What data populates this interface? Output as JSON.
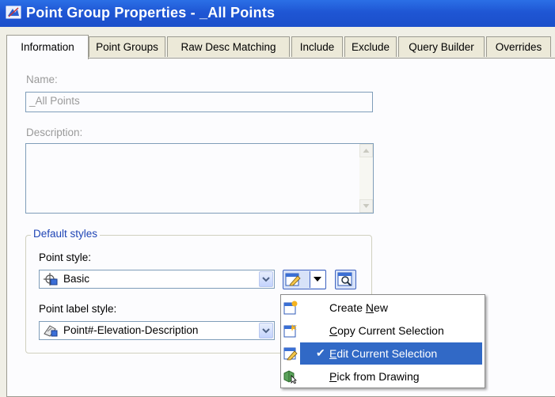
{
  "window": {
    "title": "Point Group Properties - _All Points"
  },
  "tabs": [
    {
      "label": "Information"
    },
    {
      "label": "Point Groups"
    },
    {
      "label": "Raw Desc Matching"
    },
    {
      "label": "Include"
    },
    {
      "label": "Exclude"
    },
    {
      "label": "Query Builder"
    },
    {
      "label": "Overrides"
    }
  ],
  "info": {
    "name_label": "Name:",
    "name_value": "_All Points",
    "description_label": "Description:",
    "description_value": "",
    "default_styles_label": "Default styles",
    "point_style_label": "Point style:",
    "point_style_value": "Basic",
    "point_label_style_label": "Point label style:",
    "point_label_style_value": "Point#-Elevation-Description"
  },
  "menu": {
    "items": [
      {
        "pre": "Create ",
        "ul": "N",
        "post": "ew",
        "icon": "create-new-icon"
      },
      {
        "pre": "",
        "ul": "C",
        "post": "opy Current Selection",
        "icon": "copy-selection-icon"
      },
      {
        "pre": "",
        "ul": "E",
        "post": "dit Current Selection",
        "icon": "edit-selection-icon",
        "checked": true
      },
      {
        "pre": "",
        "ul": "P",
        "post": "ick from Drawing",
        "icon": "pick-from-drawing-icon"
      }
    ]
  },
  "colors": {
    "titlebar": "#1f56d4",
    "highlight": "#3169c6",
    "groupbox_legend": "#1f45b5"
  }
}
